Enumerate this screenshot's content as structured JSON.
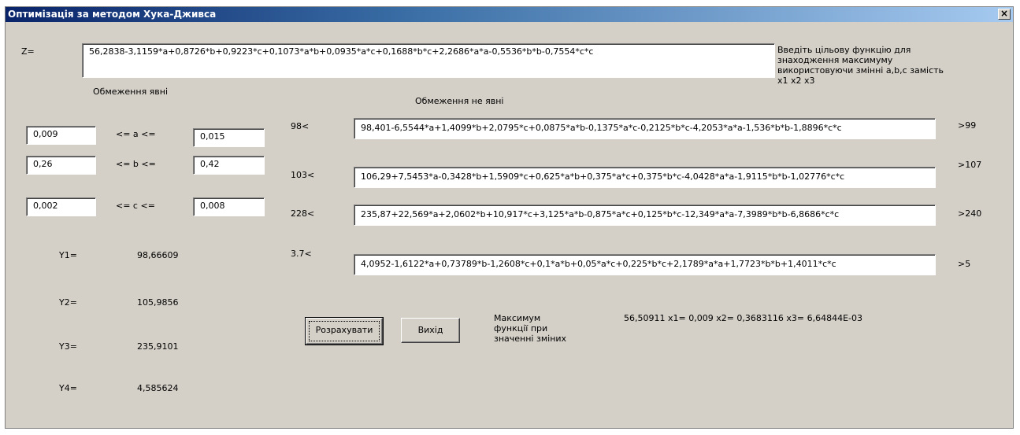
{
  "window": {
    "title": "Оптимізація за методом Хука-Дживса",
    "close_label": "×"
  },
  "objective": {
    "label": "Z=",
    "value": "56,2838-3,1159*a+0,8726*b+0,9223*c+0,1073*a*b+0,0935*a*c+0,1688*b*c+2,2686*a*a-0,5536*b*b-0,7554*c*c",
    "hint_lines": [
      "Введіть цільову функцію для",
      "знаходження максимуму",
      "використовуючи змінні a,b,c замість",
      "x1 x2 x3"
    ]
  },
  "explicit": {
    "heading": "Обмеження явні",
    "rows": [
      {
        "low": "0,009",
        "rel": "<=  a  <=",
        "high": "0,015"
      },
      {
        "low": "0,26",
        "rel": "<=  b  <=",
        "high": "0,42"
      },
      {
        "low": "0,002",
        "rel": "<=  c  <=",
        "high": "0,008"
      }
    ]
  },
  "implicit": {
    "heading": "Обмеження не явні",
    "rows": [
      {
        "left": "98<",
        "expr": "98,401-6,5544*a+1,4099*b+2,0795*c+0,0875*a*b-0,1375*a*c-0,2125*b*c-4,2053*a*a-1,536*b*b-1,8896*c*c",
        "right": ">99"
      },
      {
        "left": "103<",
        "expr": "106,29+7,5453*a-0,3428*b+1,5909*c+0,625*a*b+0,375*a*c+0,375*b*c-4,0428*a*a-1,9115*b*b-1,02776*c*c",
        "right": ">107"
      },
      {
        "left": "228<",
        "expr": "235,87+22,569*a+2,0602*b+10,917*c+3,125*a*b-0,875*a*c+0,125*b*c-12,349*a*a-7,3989*b*b-6,8686*c*c",
        "right": ">240"
      },
      {
        "left": "3.7<",
        "expr": "4,0952-1,6122*a+0,73789*b-1,2608*c+0,1*a*b+0,05*a*c+0,225*b*c+2,1789*a*a+1,7723*b*b+1,4011*c*c",
        "right": ">5"
      }
    ]
  },
  "results": [
    {
      "label": "Y1=",
      "value": "98,66609"
    },
    {
      "label": "Y2=",
      "value": "105,9856"
    },
    {
      "label": "Y3=",
      "value": "235,9101"
    },
    {
      "label": "Y4=",
      "value": "4,585624"
    }
  ],
  "buttons": {
    "calculate": "Розрахувати",
    "exit": "Вихід"
  },
  "maximum": {
    "caption_lines": [
      "Максимум",
      "функції при",
      "значенні зміних"
    ],
    "value": "56,50911 x1= 0,009 x2= 0,3683116 x3= 6,64844E-03"
  }
}
